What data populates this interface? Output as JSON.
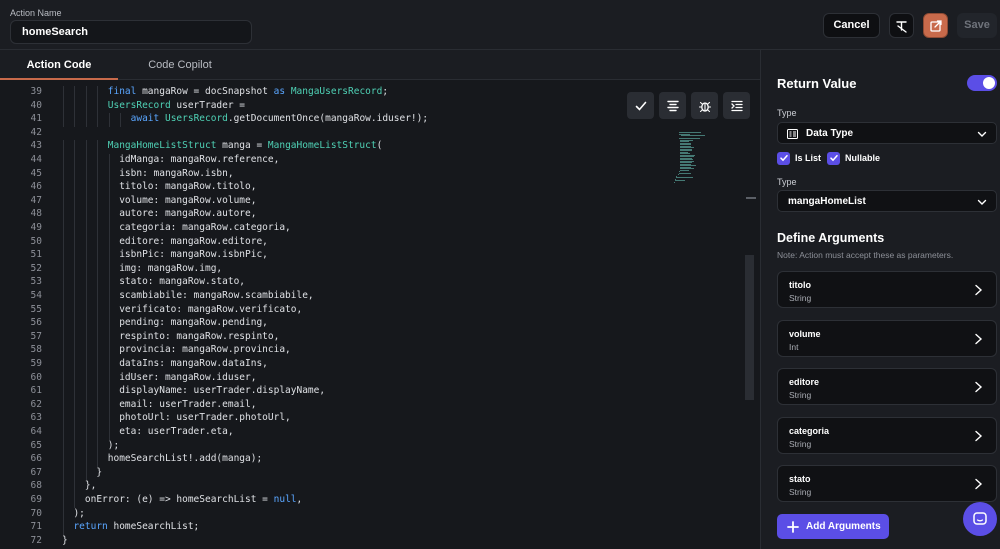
{
  "header": {
    "action_name_label": "Action Name",
    "action_name_value": "homeSearch",
    "cancel_label": "Cancel",
    "save_label": "Save"
  },
  "tabs": [
    {
      "label": "Action Code",
      "active": true
    },
    {
      "label": "Code Copilot",
      "active": false
    }
  ],
  "editor": {
    "line_numbers": [
      "39",
      "40",
      "41",
      "42",
      "43",
      "44",
      "45",
      "46",
      "47",
      "48",
      "49",
      "50",
      "51",
      "52",
      "53",
      "54",
      "55",
      "56",
      "57",
      "58",
      "59",
      "60",
      "61",
      "62",
      "63",
      "64",
      "65",
      "66",
      "67",
      "68",
      "69",
      "70",
      "71",
      "72"
    ],
    "lines": [
      {
        "indent": 4,
        "segments": [
          {
            "t": "final",
            "c": "kw"
          },
          {
            "t": " mangaRow = docSnapshot "
          },
          {
            "t": "as",
            "c": "kw"
          },
          {
            "t": " "
          },
          {
            "t": "MangaUsersRecord",
            "c": "ty"
          },
          {
            "t": ";"
          }
        ]
      },
      {
        "indent": 4,
        "segments": [
          {
            "t": "UsersRecord",
            "c": "ty"
          },
          {
            "t": " userTrader ="
          }
        ]
      },
      {
        "indent": 6,
        "segments": [
          {
            "t": "await",
            "c": "kw"
          },
          {
            "t": " "
          },
          {
            "t": "UsersRecord",
            "c": "ty"
          },
          {
            "t": ".getDocumentOnce(mangaRow.iduser!);"
          }
        ]
      },
      {
        "indent": 0,
        "segments": []
      },
      {
        "indent": 4,
        "segments": [
          {
            "t": "MangaHomeListStruct",
            "c": "ty"
          },
          {
            "t": " manga = "
          },
          {
            "t": "MangaHomeListStruct",
            "c": "ty"
          },
          {
            "t": "("
          }
        ]
      },
      {
        "indent": 5,
        "segments": [
          {
            "t": "idManga: mangaRow.reference,"
          }
        ]
      },
      {
        "indent": 5,
        "segments": [
          {
            "t": "isbn: mangaRow.isbn,"
          }
        ]
      },
      {
        "indent": 5,
        "segments": [
          {
            "t": "titolo: mangaRow.titolo,"
          }
        ]
      },
      {
        "indent": 5,
        "segments": [
          {
            "t": "volume: mangaRow.volume,"
          }
        ]
      },
      {
        "indent": 5,
        "segments": [
          {
            "t": "autore: mangaRow.autore,"
          }
        ]
      },
      {
        "indent": 5,
        "segments": [
          {
            "t": "categoria: mangaRow.categoria,"
          }
        ]
      },
      {
        "indent": 5,
        "segments": [
          {
            "t": "editore: mangaRow.editore,"
          }
        ]
      },
      {
        "indent": 5,
        "segments": [
          {
            "t": "isbnPic: mangaRow.isbnPic,"
          }
        ]
      },
      {
        "indent": 5,
        "segments": [
          {
            "t": "img: mangaRow.img,"
          }
        ]
      },
      {
        "indent": 5,
        "segments": [
          {
            "t": "stato: mangaRow.stato,"
          }
        ]
      },
      {
        "indent": 5,
        "segments": [
          {
            "t": "scambiabile: mangaRow.scambiabile,"
          }
        ]
      },
      {
        "indent": 5,
        "segments": [
          {
            "t": "verificato: mangaRow.verificato,"
          }
        ]
      },
      {
        "indent": 5,
        "segments": [
          {
            "t": "pending: mangaRow.pending,"
          }
        ]
      },
      {
        "indent": 5,
        "segments": [
          {
            "t": "respinto: mangaRow.respinto,"
          }
        ]
      },
      {
        "indent": 5,
        "segments": [
          {
            "t": "provincia: mangaRow.provincia,"
          }
        ]
      },
      {
        "indent": 5,
        "segments": [
          {
            "t": "dataIns: mangaRow.dataIns,"
          }
        ]
      },
      {
        "indent": 5,
        "segments": [
          {
            "t": "idUser: mangaRow.iduser,"
          }
        ]
      },
      {
        "indent": 5,
        "segments": [
          {
            "t": "displayName: userTrader.displayName,"
          }
        ]
      },
      {
        "indent": 5,
        "segments": [
          {
            "t": "email: userTrader.email,"
          }
        ]
      },
      {
        "indent": 5,
        "segments": [
          {
            "t": "photoUrl: userTrader.photoUrl,"
          }
        ]
      },
      {
        "indent": 5,
        "segments": [
          {
            "t": "eta: userTrader.eta,"
          }
        ]
      },
      {
        "indent": 4,
        "segments": [
          {
            "t": ");"
          }
        ]
      },
      {
        "indent": 4,
        "segments": [
          {
            "t": "homeSearchList!.add(manga);"
          }
        ]
      },
      {
        "indent": 3,
        "segments": [
          {
            "t": "}"
          }
        ]
      },
      {
        "indent": 2,
        "segments": [
          {
            "t": "},"
          }
        ]
      },
      {
        "indent": 2,
        "segments": [
          {
            "t": "onError: (e) => homeSearchList = "
          },
          {
            "t": "null",
            "c": "kw"
          },
          {
            "t": ","
          }
        ]
      },
      {
        "indent": 1,
        "segments": [
          {
            "t": ");"
          }
        ]
      },
      {
        "indent": 1,
        "segments": [
          {
            "t": "return",
            "c": "kw"
          },
          {
            "t": " homeSearchList;"
          }
        ]
      },
      {
        "indent": 0,
        "segments": [
          {
            "t": "}"
          }
        ]
      }
    ]
  },
  "panel": {
    "return_value_title": "Return Value",
    "return_value_enabled": true,
    "type_label": "Type",
    "type_value": "Data Type",
    "is_list_label": "Is List",
    "is_list_checked": true,
    "nullable_label": "Nullable",
    "nullable_checked": true,
    "type2_label": "Type",
    "type2_value": "mangaHomeList",
    "define_args_title": "Define Arguments",
    "define_args_note": "Note: Action must accept these as parameters.",
    "arguments": [
      {
        "name": "titolo",
        "type": "String"
      },
      {
        "name": "volume",
        "type": "Int"
      },
      {
        "name": "editore",
        "type": "String"
      },
      {
        "name": "categoria",
        "type": "String"
      },
      {
        "name": "stato",
        "type": "String"
      }
    ],
    "add_arguments_label": "Add Arguments"
  },
  "colors": {
    "accent": "#5b4ee6",
    "export_button": "#c86a4b",
    "keyword": "#5aa6ff",
    "type": "#4fd1b5"
  },
  "icons": [
    "format-icon",
    "export-icon",
    "check-icon",
    "align-center-icon",
    "bug-icon",
    "indent-icon",
    "data-type-icon",
    "chevron-down-icon",
    "chevron-right-icon",
    "plus-icon",
    "chat-icon"
  ]
}
